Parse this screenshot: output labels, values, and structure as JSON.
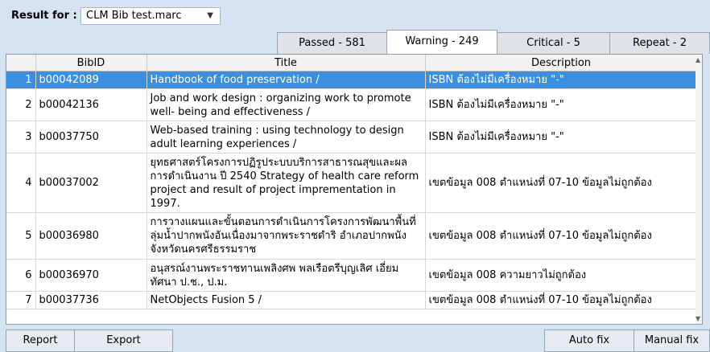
{
  "header": {
    "result_label": "Result for :",
    "result_value": "CLM Bib test.marc"
  },
  "tabs": [
    {
      "label": "Passed - 581"
    },
    {
      "label": "Warning - 249",
      "active": true
    },
    {
      "label": "Critical - 5"
    },
    {
      "label": "Repeat - 2"
    }
  ],
  "table": {
    "columns": [
      "",
      "BibID",
      "Title",
      "Description"
    ],
    "rows": [
      {
        "num": "1",
        "bibid": "b00042089",
        "title": "Handbook of food preservation /",
        "desc": "ISBN ต้องไม่มีเครื่องหมาย \"-\"",
        "selected": true
      },
      {
        "num": "2",
        "bibid": "b00042136",
        "title": "Job and work design :  organizing work to promote well- being and effectiveness /",
        "desc": "ISBN ต้องไม่มีเครื่องหมาย \"-\""
      },
      {
        "num": "3",
        "bibid": "b00037750",
        "title": "Web-based training :  using technology to design adult learning experiences /",
        "desc": "ISBN ต้องไม่มีเครื่องหมาย \"-\""
      },
      {
        "num": "4",
        "bibid": "b00037002",
        "title": "ยุทธศาสตร์โครงการปฏิรูประบบบริการสาธารณสุขและผลการดำเนินงาน ปี 2540  Strategy of health care reform project and result of project imprementation in 1997.",
        "desc": "เขตข้อมูล 008 ตำแหน่งที่ 07-10 ข้อมูลไม่ถูกต้อง"
      },
      {
        "num": "5",
        "bibid": "b00036980",
        "title": "การวางแผนและขั้นตอนการดำเนินการโครงการพัฒนาพื้นที่ลุ่มน้ำปากพนังอันเนื่องมาจากพระราชดำริ อำเภอปากพนัง จังหวัดนครศรีธรรมราช",
        "desc": "เขตข้อมูล 008 ตำแหน่งที่ 07-10 ข้อมูลไม่ถูกต้อง"
      },
      {
        "num": "6",
        "bibid": "b00036970",
        "title": "อนุสรณ์งานพระราชทานเพลิงศพ พลเรือตรีบุญเลิศ เอี่ยมทัศนา ป.ช., ป.ม.",
        "desc": "เขตข้อมูล 008 ความยาวไม่ถูกต้อง"
      },
      {
        "num": "7",
        "bibid": "b00037736",
        "title": "NetObjects Fusion 5 /",
        "desc": "เขตข้อมูล 008 ตำแหน่งที่ 07-10 ข้อมูลไม่ถูกต้อง"
      }
    ]
  },
  "footer": {
    "report": "Report",
    "export": "Export",
    "auto_fix": "Auto fix",
    "manual_fix": "Manual fix"
  },
  "colors": {
    "background": "#d4e2f2",
    "selection": "#3a8fe0"
  }
}
